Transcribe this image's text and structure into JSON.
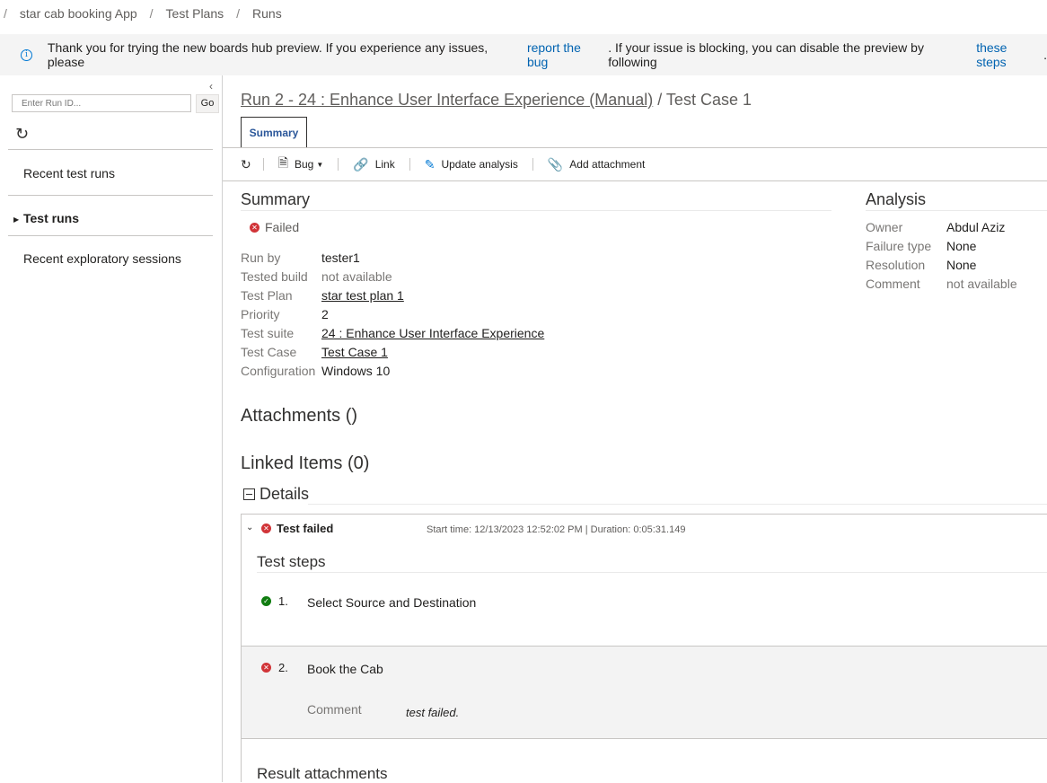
{
  "breadcrumb": {
    "items": [
      "star cab booking App",
      "Test Plans",
      "Runs"
    ],
    "separator": "/"
  },
  "banner": {
    "text1": "Thank you for trying the new boards hub preview. If you experience any issues, please",
    "link1": "report the bug",
    "text2": ". If your issue is blocking, you can disable the preview by following",
    "link2": "these steps",
    "text3": "."
  },
  "left": {
    "run_id_placeholder": "Enter Run ID...",
    "go_label": "Go",
    "nav": [
      "Recent test runs",
      "Test runs",
      "Recent exploratory sessions"
    ]
  },
  "header": {
    "run_link": "Run 2 - 24 : Enhance User Interface Experience (Manual)",
    "title_suffix": " / Test Case 1",
    "tab_summary": "Summary"
  },
  "toolbar": {
    "bug": "Bug",
    "link": "Link",
    "update_analysis": "Update analysis",
    "add_attachment": "Add attachment"
  },
  "summary": {
    "heading": "Summary",
    "status": "Failed",
    "fields": [
      {
        "label": "Run by",
        "value": "tester1",
        "link": false
      },
      {
        "label": "Tested build",
        "value": "not available",
        "link": false
      },
      {
        "label": "Test Plan",
        "value": "star test plan 1",
        "link": true
      },
      {
        "label": "Priority",
        "value": "2",
        "link": false
      },
      {
        "label": "Test suite",
        "value": "24 : Enhance User Interface Experience",
        "link": true
      },
      {
        "label": "Test Case",
        "value": "Test Case 1",
        "link": true
      },
      {
        "label": "Configuration",
        "value": "Windows 10",
        "link": false
      }
    ]
  },
  "analysis": {
    "heading": "Analysis",
    "fields": [
      {
        "label": "Owner",
        "value": "Abdul Aziz"
      },
      {
        "label": "Failure type",
        "value": "None"
      },
      {
        "label": "Resolution",
        "value": "None"
      },
      {
        "label": "Comment",
        "value": "not available"
      }
    ]
  },
  "attachments_heading": "Attachments ()",
  "linked_heading": "Linked Items (0)",
  "details": {
    "heading": "Details",
    "result_label": "Test failed",
    "meta": "Start time: 12/13/2023 12:52:02 PM | Duration: 0:05:31.149",
    "steps_heading": "Test steps",
    "steps": [
      {
        "num": "1.",
        "text": "Select Source and Destination",
        "status": "passed"
      },
      {
        "num": "2.",
        "text": "Book the Cab",
        "status": "failed"
      }
    ],
    "comment_label": "Comment",
    "comment_value": "test failed.",
    "result_attachments_heading": "Result attachments"
  },
  "colors": {
    "failed": "#d13438",
    "passed": "#107c10",
    "link": "#0063b1",
    "tab_text": "#2b579a"
  }
}
